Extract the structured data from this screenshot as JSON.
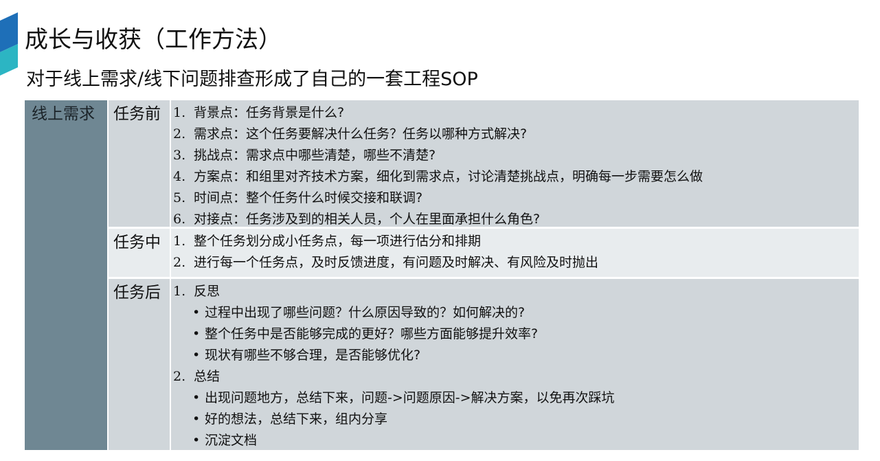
{
  "page": {
    "title": "成长与收获（工作方法）",
    "subtitle": "对于线上需求/线下问题排查形成了自己的一套工程SOP"
  },
  "table": {
    "main_label": "线上需求",
    "rows": [
      {
        "label": "任务前",
        "items": [
          {
            "num": "1.",
            "text": "背景点：任务背景是什么?"
          },
          {
            "num": "2.",
            "text": "需求点：这个任务要解决什么任务？任务以哪种方式解决?"
          },
          {
            "num": "3.",
            "text": "挑战点：需求点中哪些清楚，哪些不清楚?"
          },
          {
            "num": "4.",
            "text": "方案点：和组里对齐技术方案，细化到需求点，讨论清楚挑战点，明确每一步需要怎么做"
          },
          {
            "num": "5.",
            "text": "时间点：整个任务什么时候交接和联调?"
          },
          {
            "num": "6.",
            "text": "对接点：任务涉及到的相关人员，个人在里面承担什么角色?"
          }
        ]
      },
      {
        "label": "任务中",
        "items": [
          {
            "num": "1.",
            "text": "整个任务划分成小任务点，每一项进行估分和排期"
          },
          {
            "num": "2.",
            "text": "进行每一个任务点，及时反馈进度，有问题及时解决、有风险及时抛出"
          }
        ]
      },
      {
        "label": "任务后",
        "items": [
          {
            "num": "1.",
            "text": "反思"
          },
          {
            "bullet": "•",
            "text": "过程中出现了哪些问题？什么原因导致的？如何解决的?"
          },
          {
            "bullet": "•",
            "text": "整个任务中是否能够完成的更好？哪些方面能够提升效率?"
          },
          {
            "bullet": "•",
            "text": "现状有哪些不够合理，是否能够优化?"
          },
          {
            "num": "2.",
            "text": "总结"
          },
          {
            "bullet": "•",
            "text": "出现问题地方，总结下来，问题->问题原因->解决方案，以免再次踩坑"
          },
          {
            "bullet": "•",
            "text": "好的想法，总结下来，组内分享"
          },
          {
            "bullet": "•",
            "text": "沉淀文档"
          }
        ]
      }
    ]
  },
  "colors": {
    "main_column": "#6f8793",
    "row_dark": "#d0d6da",
    "row_light": "#e8ecee",
    "accent_blue": "#1e6fb8",
    "accent_teal": "#2cb5c3"
  }
}
